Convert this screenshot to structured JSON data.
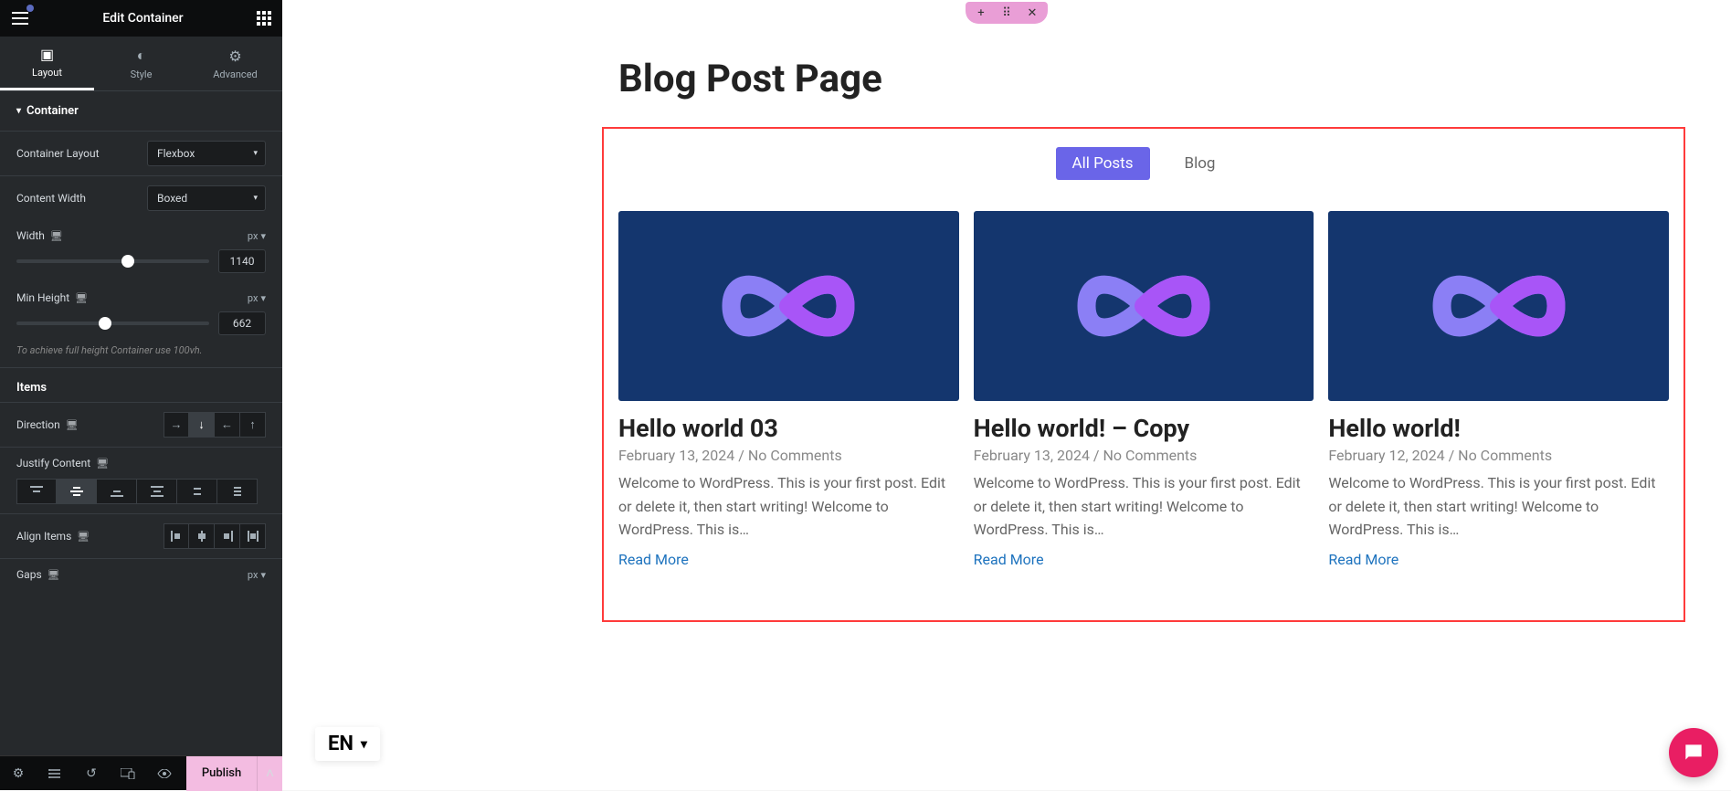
{
  "header": {
    "title": "Edit Container"
  },
  "tabs": {
    "layout": "Layout",
    "style": "Style",
    "advanced": "Advanced"
  },
  "section": {
    "title": "Container"
  },
  "controls": {
    "containerLayout": {
      "label": "Container Layout",
      "value": "Flexbox"
    },
    "contentWidth": {
      "label": "Content Width",
      "value": "Boxed"
    },
    "width": {
      "label": "Width",
      "unit": "px",
      "value": "1140"
    },
    "minHeight": {
      "label": "Min Height",
      "unit": "px",
      "value": "662",
      "help": "To achieve full height Container use 100vh."
    },
    "itemsHeading": "Items",
    "direction": {
      "label": "Direction"
    },
    "justifyContent": {
      "label": "Justify Content"
    },
    "alignItems": {
      "label": "Align Items"
    },
    "gaps": {
      "label": "Gaps",
      "unit": "px"
    }
  },
  "footer": {
    "publish": "Publish"
  },
  "page": {
    "title": "Blog Post Page",
    "filters": [
      {
        "label": "All Posts",
        "active": true
      },
      {
        "label": "Blog",
        "active": false
      }
    ],
    "posts": [
      {
        "title": "Hello world 03",
        "date": "February 13, 2024",
        "comments": "No Comments",
        "excerpt": "Welcome to WordPress. This is your first post. Edit or delete it, then start writing! Welcome to WordPress. This is…",
        "readMore": "Read More"
      },
      {
        "title": "Hello world! – Copy",
        "date": "February 13, 2024",
        "comments": "No Comments",
        "excerpt": "Welcome to WordPress. This is your first post. Edit or delete it, then start writing! Welcome to WordPress. This is…",
        "readMore": "Read More"
      },
      {
        "title": "Hello world!",
        "date": "February 12, 2024",
        "comments": "No Comments",
        "excerpt": "Welcome to WordPress. This is your first post. Edit or delete it, then start writing! Welcome to WordPress. This is…",
        "readMore": "Read More"
      }
    ],
    "lang": "EN"
  }
}
